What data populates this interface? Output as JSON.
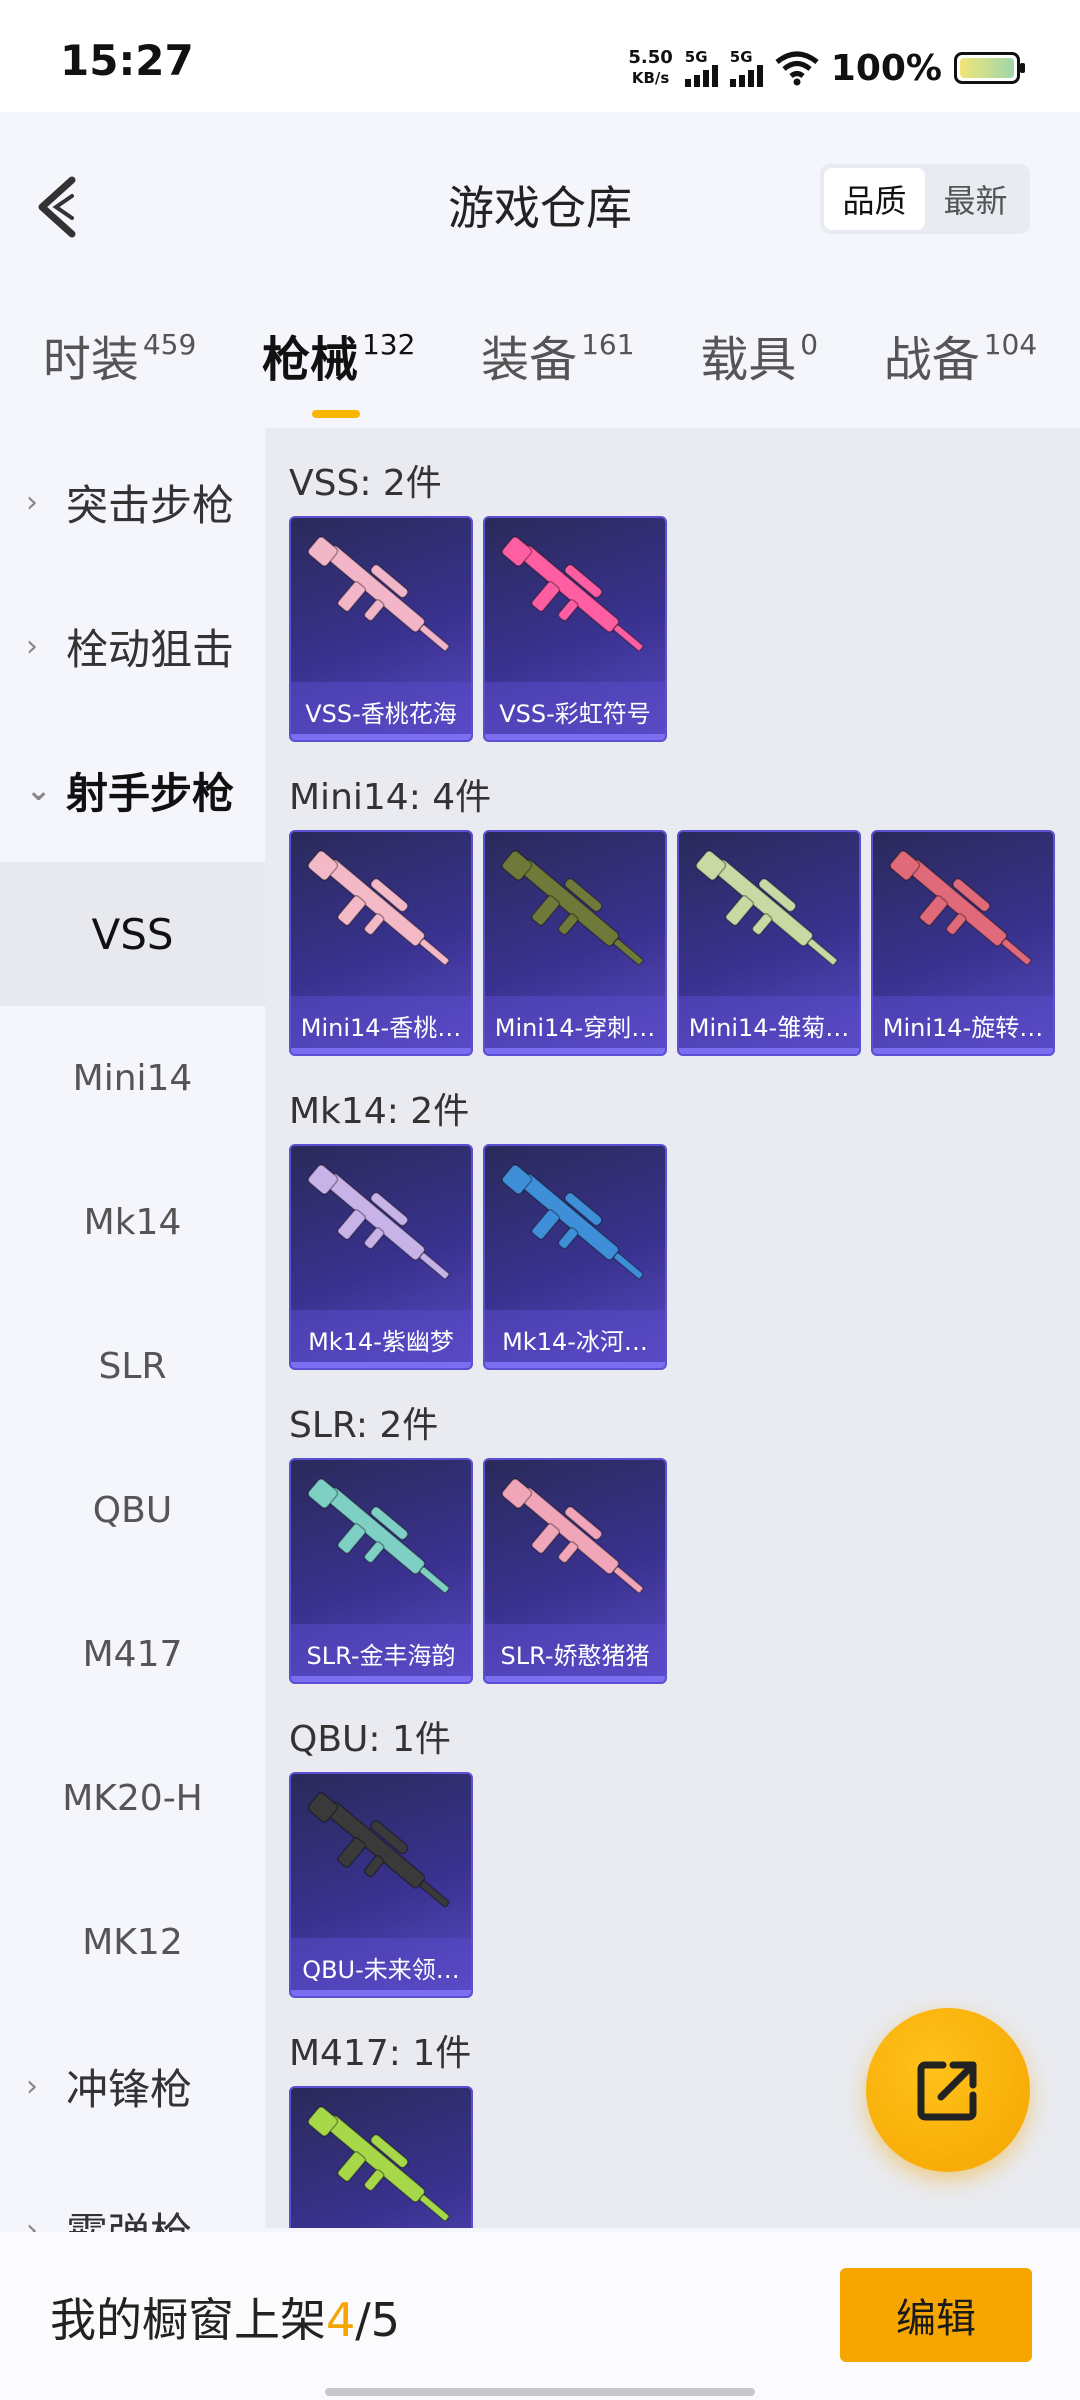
{
  "status_bar": {
    "time": "15:27",
    "net_speed_value": "5.50",
    "net_speed_unit": "KB/s",
    "signal1_label": "5G",
    "signal2_label": "5G",
    "battery_percent": "100%"
  },
  "header": {
    "title": "游戏仓库",
    "sort_options": [
      "品质",
      "最新"
    ],
    "sort_selected": "品质"
  },
  "tabs": [
    {
      "label": "时装",
      "count": "459"
    },
    {
      "label": "枪械",
      "count": "132"
    },
    {
      "label": "装备",
      "count": "161"
    },
    {
      "label": "载具",
      "count": "0"
    },
    {
      "label": "战备",
      "count": "104"
    }
  ],
  "active_tab": "枪械",
  "sidebar": {
    "categories": [
      {
        "label": "突击步枪"
      },
      {
        "label": "栓动狙击"
      },
      {
        "label": "射手步枪"
      }
    ],
    "subitems": [
      "VSS",
      "Mini14",
      "Mk14",
      "SLR",
      "QBU",
      "M417",
      "MK20-H",
      "MK12"
    ],
    "more_categories": [
      {
        "label": "冲锋枪"
      },
      {
        "label": "霰弹枪"
      }
    ],
    "active_subitem": "VSS"
  },
  "groups": [
    {
      "title": "VSS: 2件",
      "items": [
        {
          "label": "VSS-香桃花海",
          "icon": "pink-sniper-rifle",
          "color": "#f2b6c8"
        },
        {
          "label": "VSS-彩虹符号",
          "icon": "rainbow-sniper-rifle",
          "color": "#ff5fa2"
        }
      ]
    },
    {
      "title": "Mini14: 4件",
      "items": [
        {
          "label": "Mini14-香桃…",
          "icon": "pink-rifle",
          "color": "#f4b9c7"
        },
        {
          "label": "Mini14-穿刺…",
          "icon": "olive-rifle",
          "color": "#6f7a3a"
        },
        {
          "label": "Mini14-雏菊…",
          "icon": "pale-green-rifle",
          "color": "#c9d9a4"
        },
        {
          "label": "Mini14-旋转…",
          "icon": "red-rifle",
          "color": "#e06a7a"
        }
      ]
    },
    {
      "title": "Mk14: 2件",
      "items": [
        {
          "label": "Mk14-紫幽梦",
          "icon": "lavender-rifle",
          "color": "#c8b3e8"
        },
        {
          "label": "Mk14-冰河…",
          "icon": "ice-blue-rifle",
          "color": "#3f8fd8"
        }
      ]
    },
    {
      "title": "SLR: 2件",
      "items": [
        {
          "label": "SLR-金丰海韵",
          "icon": "teal-rifle",
          "color": "#7fd0c4"
        },
        {
          "label": "SLR-娇憨猪猪",
          "icon": "pink-rifle",
          "color": "#f0a6b8"
        }
      ]
    },
    {
      "title": "QBU: 1件",
      "items": [
        {
          "label": "QBU-未来领…",
          "icon": "black-rifle",
          "color": "#3a3a3a"
        }
      ]
    },
    {
      "title": "M417: 1件",
      "items": [
        {
          "label": "",
          "icon": "green-yellow-rifle",
          "color": "#a6d84a"
        }
      ]
    }
  ],
  "bottom_bar": {
    "shelf_label": "我的橱窗上架",
    "shelf_current": "4",
    "shelf_total": "/5",
    "edit_label": "编辑"
  },
  "colors": {
    "accent": "#f7a600",
    "card_bg": "#3a3290"
  }
}
